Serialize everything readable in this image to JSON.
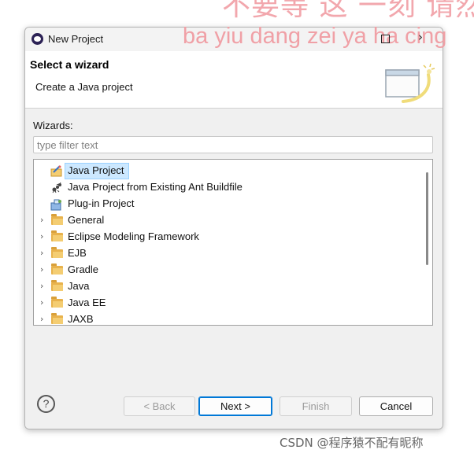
{
  "overlay": {
    "top_text": "不要等 这 一刻 请然",
    "sub_text": "ba yiu dang zei ya ha cing"
  },
  "window": {
    "title": "New Project",
    "icon": "eclipse-icon"
  },
  "banner": {
    "title": "Select a wizard",
    "description": "Create a Java project",
    "graphic": "wizard-banner-graphic"
  },
  "wizards": {
    "label": "Wizards:",
    "filter_placeholder": "type filter text",
    "items": [
      {
        "label": "Java Project",
        "icon": "java-project-icon",
        "expandable": false,
        "selected": true
      },
      {
        "label": "Java Project from Existing Ant Buildfile",
        "icon": "ant-icon",
        "expandable": false,
        "selected": false
      },
      {
        "label": "Plug-in Project",
        "icon": "plugin-project-icon",
        "expandable": false,
        "selected": false
      },
      {
        "label": "General",
        "icon": "folder-icon",
        "expandable": true,
        "selected": false
      },
      {
        "label": "Eclipse Modeling Framework",
        "icon": "folder-icon",
        "expandable": true,
        "selected": false
      },
      {
        "label": "EJB",
        "icon": "folder-icon",
        "expandable": true,
        "selected": false
      },
      {
        "label": "Gradle",
        "icon": "folder-icon",
        "expandable": true,
        "selected": false
      },
      {
        "label": "Java",
        "icon": "folder-icon",
        "expandable": true,
        "selected": false
      },
      {
        "label": "Java EE",
        "icon": "folder-icon",
        "expandable": true,
        "selected": false
      },
      {
        "label": "JAXB",
        "icon": "folder-icon",
        "expandable": true,
        "selected": false
      }
    ]
  },
  "footer": {
    "help_icon": "?",
    "buttons": {
      "back": "< Back",
      "next": "Next >",
      "finish": "Finish",
      "cancel": "Cancel"
    }
  },
  "watermark": "CSDN @程序猿不配有昵称",
  "colors": {
    "selection": "#cce8ff",
    "overlay_text": "#f2a7ad",
    "default_button_border": "#0078d7"
  }
}
